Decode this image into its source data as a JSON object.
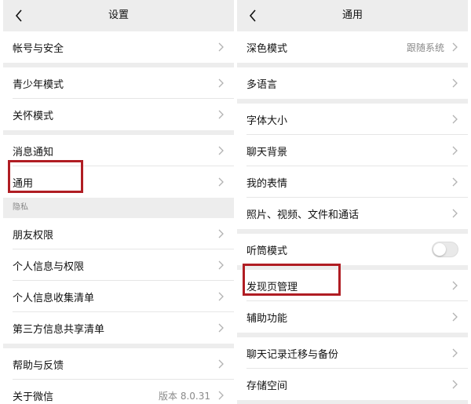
{
  "left": {
    "title": "设置",
    "rows": {
      "account_security": "帐号与安全",
      "teen_mode": "青少年模式",
      "care_mode": "关怀模式",
      "notifications": "消息通知",
      "general": "通用",
      "privacy_header": "隐私",
      "friend_permissions": "朋友权限",
      "personal_info_permissions": "个人信息与权限",
      "personal_info_list": "个人信息收集清单",
      "third_party_list": "第三方信息共享清单",
      "help_feedback": "帮助与反馈",
      "about": "关于微信",
      "version": "版本 8.0.31"
    }
  },
  "right": {
    "title": "通用",
    "rows": {
      "dark_mode": "深色模式",
      "dark_mode_value": "跟随系统",
      "language": "多语言",
      "font_size": "字体大小",
      "chat_background": "聊天背景",
      "my_stickers": "我的表情",
      "media_files": "照片、视频、文件和通话",
      "earpiece_mode": "听筒模式",
      "discover_management": "发现页管理",
      "accessibility": "辅助功能",
      "chat_migration": "聊天记录迁移与备份",
      "storage": "存储空间"
    },
    "earpiece_mode_on": false
  },
  "colors": {
    "highlight": "#b01d23",
    "background": "#ededed",
    "row": "#ffffff"
  },
  "icons": {
    "back": "chevron-left-icon",
    "row_arrow": "chevron-right-icon"
  }
}
